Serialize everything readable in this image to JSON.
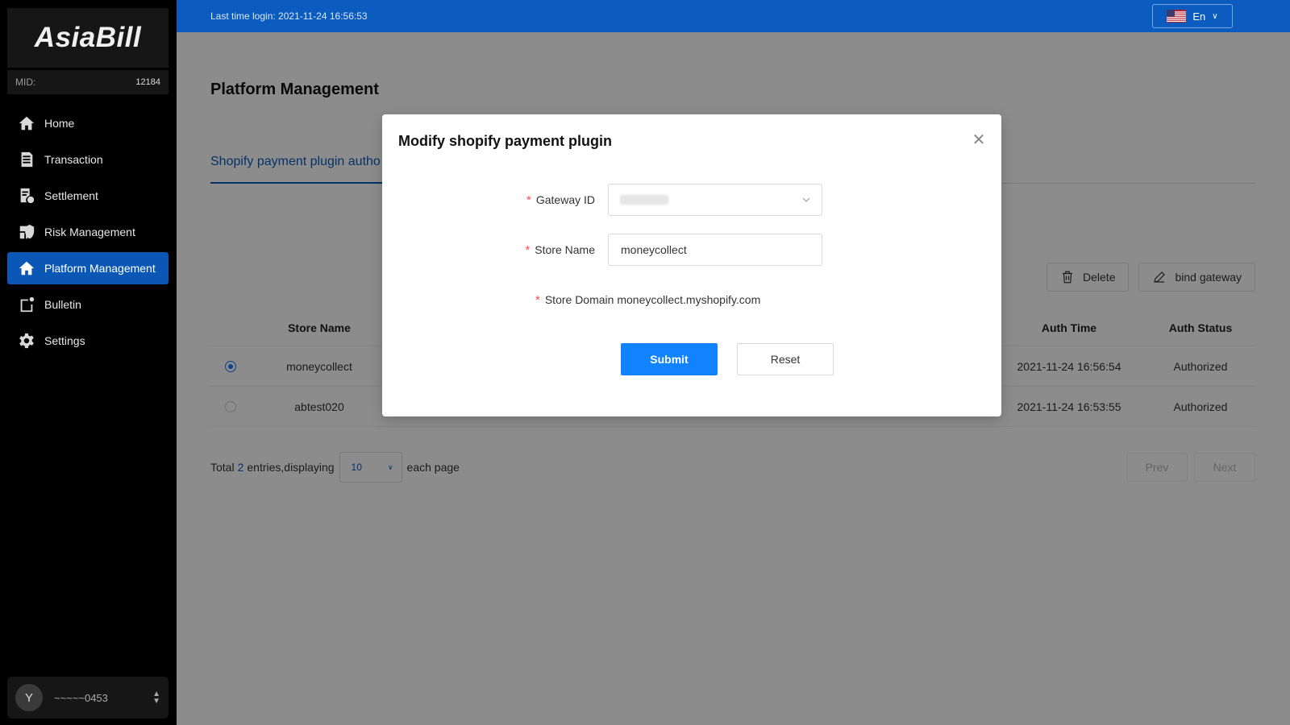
{
  "brand": {
    "logo": "AsiaBill",
    "mid_label": "MID:",
    "mid_value": "12184"
  },
  "sidebar": {
    "items": [
      {
        "label": "Home",
        "icon": "home-icon"
      },
      {
        "label": "Transaction",
        "icon": "document-icon"
      },
      {
        "label": "Settlement",
        "icon": "settlement-icon"
      },
      {
        "label": "Risk Management",
        "icon": "shield-icon"
      },
      {
        "label": "Platform Management",
        "icon": "home-icon",
        "active": true
      },
      {
        "label": "Bulletin",
        "icon": "bulletin-icon"
      },
      {
        "label": "Settings",
        "icon": "gear-icon"
      }
    ]
  },
  "user": {
    "initial": "Y",
    "name": "~~~~~0453"
  },
  "header": {
    "last_login": "Last time login: 2021-11-24 16:56:53",
    "language": "En"
  },
  "page": {
    "title": "Platform Management",
    "tab": "Shopify payment plugin autho",
    "actions": {
      "delete": "Delete",
      "bind": "bind gateway"
    }
  },
  "table": {
    "headers": {
      "store_name": "Store Name",
      "auth_time": "Auth Time",
      "auth_status": "Auth Status"
    },
    "rows": [
      {
        "store": "moneycollect",
        "time": "2021-11-24 16:56:54",
        "status": "Authorized",
        "selected": true
      },
      {
        "store": "abtest020",
        "time": "2021-11-24 16:53:55",
        "status": "Authorized",
        "selected": false
      }
    ]
  },
  "pager": {
    "prefix": "Total",
    "count": "2",
    "middle": "entries,displaying",
    "page_size": "10",
    "suffix": "each page",
    "prev": "Prev",
    "next": "Next"
  },
  "modal": {
    "title": "Modify shopify payment plugin",
    "gateway_label": "Gateway ID",
    "store_name_label": "Store Name",
    "store_name_value": "moneycollect",
    "store_domain_label": "Store Domain",
    "store_domain_value": "moneycollect.myshopify.com",
    "submit": "Submit",
    "reset": "Reset"
  },
  "colors": {
    "primary": "#0b5cbe",
    "button": "#1283ff",
    "required": "#ff4d4f",
    "sidebar_bg": "#000000"
  }
}
